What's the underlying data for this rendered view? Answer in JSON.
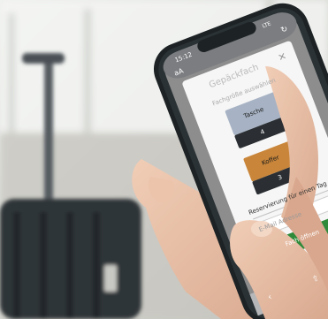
{
  "status_bar": {
    "time": "15:12",
    "network": "LTE"
  },
  "browser": {
    "text_size_label": "aA",
    "reload_icon": "reload-icon"
  },
  "modal": {
    "title": "Gepäckfach",
    "section_label": "Fachgröße auswählen",
    "close_icon": "close-icon",
    "options": [
      {
        "name": "Tasche",
        "count": "4",
        "color": "#a7b3c4"
      },
      {
        "name": "Koffer",
        "count": "3",
        "color": "#c9863a"
      }
    ],
    "reservation_text": "Reservierung für einen Tag",
    "email_placeholder": "E-Mail Adresse",
    "submit_label": "Fach öffnen",
    "submit_color": "#2f8a3a"
  },
  "bottom_bar": {
    "back_icon": "chevron-left-icon",
    "share_icon": "share-icon"
  }
}
